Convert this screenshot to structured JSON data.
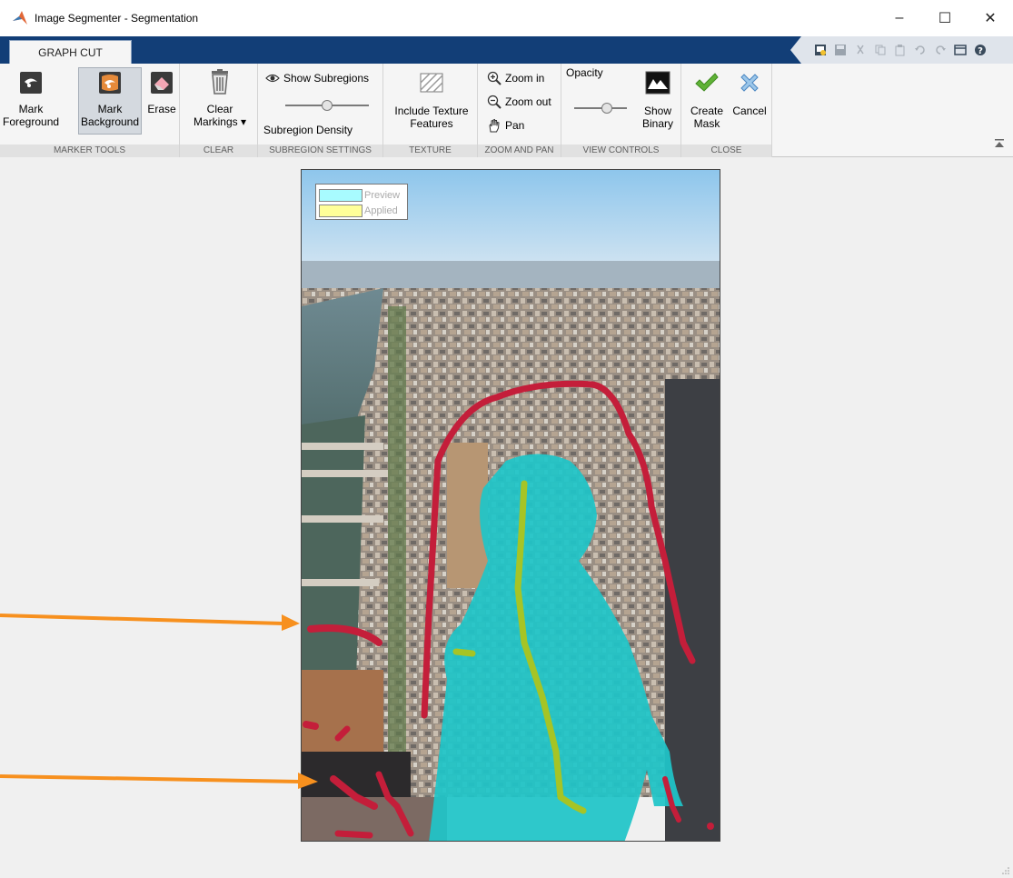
{
  "window": {
    "title": "Image Segmenter - Segmentation",
    "minimize": "–",
    "maximize": "☐",
    "close": "✕"
  },
  "ribbon": {
    "active_tab": "GRAPH CUT",
    "sections": {
      "marker_tools": {
        "label": "MARKER TOOLS",
        "mark_foreground_line1": "Mark",
        "mark_foreground_line2": "Foreground",
        "mark_background_line1": "Mark",
        "mark_background_line2": "Background",
        "erase": "Erase"
      },
      "clear": {
        "label": "CLEAR",
        "clear_markings_line1": "Clear",
        "clear_markings_line2": "Markings ▾"
      },
      "subregion_settings": {
        "label": "SUBREGION SETTINGS",
        "show_subregions": "Show Subregions",
        "subregion_density": "Subregion Density",
        "density_level": 0.5
      },
      "texture": {
        "label": "TEXTURE",
        "include_texture_line1": "Include Texture",
        "include_texture_line2": "Features"
      },
      "zoom_and_pan": {
        "label": "ZOOM AND PAN",
        "zoom_in": "Zoom in",
        "zoom_out": "Zoom out",
        "pan": "Pan"
      },
      "view_controls": {
        "label": "VIEW CONTROLS",
        "opacity": "Opacity",
        "opacity_level": 0.6,
        "show_binary_line1": "Show",
        "show_binary_line2": "Binary"
      },
      "close": {
        "label": "CLOSE",
        "create_mask_line1": "Create",
        "create_mask_line2": "Mask",
        "cancel": "Cancel"
      }
    }
  },
  "legend": {
    "preview": "Preview",
    "applied": "Applied",
    "preview_color": "#a8fbff",
    "applied_color": "#ffff99"
  },
  "colors": {
    "tabstrip": "#123e77",
    "foreground_marking": "#99cc22",
    "background_marking": "#c41e3a",
    "preview_overlay": "#1fc5c8",
    "annotation_arrow": "#f7901e"
  }
}
